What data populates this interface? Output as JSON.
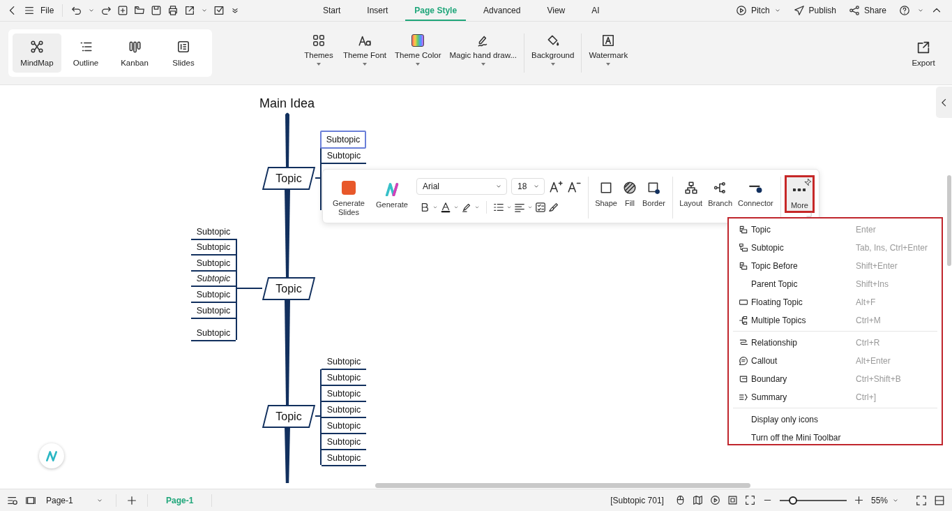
{
  "title_bar": {
    "file_label": "File",
    "tabs": [
      {
        "label": "Start",
        "selected": false
      },
      {
        "label": "Insert",
        "selected": false
      },
      {
        "label": "Page Style",
        "selected": true
      },
      {
        "label": "Advanced",
        "selected": false
      },
      {
        "label": "View",
        "selected": false
      },
      {
        "label": "AI",
        "selected": false
      }
    ],
    "actions": [
      {
        "kind": "pitch",
        "label": "Pitch"
      },
      {
        "kind": "publish",
        "label": "Publish"
      },
      {
        "kind": "share",
        "label": "Share"
      }
    ]
  },
  "ribbon": {
    "views": [
      {
        "kind": "mindmap",
        "label": "MindMap",
        "selected": true
      },
      {
        "kind": "outline",
        "label": "Outline",
        "selected": false
      },
      {
        "kind": "kanban",
        "label": "Kanban",
        "selected": false
      },
      {
        "kind": "slides",
        "label": "Slides",
        "selected": false
      }
    ],
    "tools": [
      {
        "kind": "themes",
        "label": "Themes"
      },
      {
        "kind": "font",
        "label": "Theme Font"
      },
      {
        "kind": "color",
        "label": "Theme Color"
      },
      {
        "kind": "hand",
        "label": "Magic hand draw..."
      },
      {
        "kind": "background",
        "label": "Background"
      },
      {
        "kind": "watermark",
        "label": "Watermark"
      }
    ],
    "export_label": "Export"
  },
  "mind_map": {
    "main_idea": "Main Idea",
    "topics": [
      {
        "label": "Topic",
        "subtopics": [
          {
            "label": "Subtopic",
            "selected": true,
            "italic": false
          },
          {
            "label": "Subtopic",
            "selected": false,
            "italic": false
          }
        ]
      },
      {
        "label": "Topic",
        "subtopics": [
          {
            "label": "Subtopic",
            "selected": false,
            "italic": false
          },
          {
            "label": "Subtopic",
            "selected": false,
            "italic": false
          },
          {
            "label": "Subtopic",
            "selected": false,
            "italic": false
          },
          {
            "label": "Subtopic",
            "selected": false,
            "italic": true
          },
          {
            "label": "Subtopic",
            "selected": false,
            "italic": false
          },
          {
            "label": "Subtopic",
            "selected": false,
            "italic": false
          },
          {
            "label": "Subtopic",
            "selected": false,
            "italic": false
          }
        ]
      },
      {
        "label": "Topic",
        "subtopics": [
          {
            "label": "Subtopic",
            "selected": false,
            "italic": false
          },
          {
            "label": "Subtopic",
            "selected": false,
            "italic": false
          },
          {
            "label": "Subtopic",
            "selected": false,
            "italic": false
          },
          {
            "label": "Subtopic",
            "selected": false,
            "italic": false
          },
          {
            "label": "Subtopic",
            "selected": false,
            "italic": false
          },
          {
            "label": "Subtopic",
            "selected": false,
            "italic": false
          },
          {
            "label": "Subtopic",
            "selected": false,
            "italic": false
          }
        ]
      }
    ]
  },
  "mini_toolbar": {
    "generate_slides": "Generate Slides",
    "generate": "Generate",
    "font": "Arial",
    "font_size": "18",
    "buttons": [
      {
        "kind": "shape",
        "label": "Shape"
      },
      {
        "kind": "fill",
        "label": "Fill"
      },
      {
        "kind": "border",
        "label": "Border"
      },
      {
        "kind": "layout",
        "label": "Layout"
      },
      {
        "kind": "branch",
        "label": "Branch"
      },
      {
        "kind": "connector",
        "label": "Connector"
      }
    ],
    "more": {
      "label": "More",
      "selected": true
    }
  },
  "more_menu": {
    "sections": [
      [
        {
          "kind": "topic",
          "label": "Topic",
          "shortcut": "Enter"
        },
        {
          "kind": "subtopic",
          "label": "Subtopic",
          "shortcut": "Tab, Ins, Ctrl+Enter"
        },
        {
          "kind": "topic",
          "label": "Topic Before",
          "shortcut": "Shift+Enter"
        },
        {
          "kind": "plain",
          "label": "Parent Topic",
          "shortcut": "Shift+Ins"
        },
        {
          "kind": "floating",
          "label": "Floating Topic",
          "shortcut": "Alt+F"
        },
        {
          "kind": "multiple",
          "label": "Multiple Topics",
          "shortcut": "Ctrl+M"
        }
      ],
      [
        {
          "kind": "relationship",
          "label": "Relationship",
          "shortcut": "Ctrl+R"
        },
        {
          "kind": "callout",
          "label": "Callout",
          "shortcut": "Alt+Enter"
        },
        {
          "kind": "boundary",
          "label": "Boundary",
          "shortcut": "Ctrl+Shift+B"
        },
        {
          "kind": "summary",
          "label": "Summary",
          "shortcut": "Ctrl+]"
        }
      ],
      [
        {
          "kind": "plain",
          "label": "Display only icons"
        },
        {
          "kind": "plain",
          "label": "Turn off the Mini Toolbar"
        }
      ]
    ]
  },
  "status_bar": {
    "page_select": "Page-1",
    "pages": [
      {
        "label": "Page-1",
        "selected": true
      }
    ],
    "selection_info": "[Subtopic 701]",
    "zoom": {
      "level": 0.2,
      "reading": "55%"
    }
  }
}
